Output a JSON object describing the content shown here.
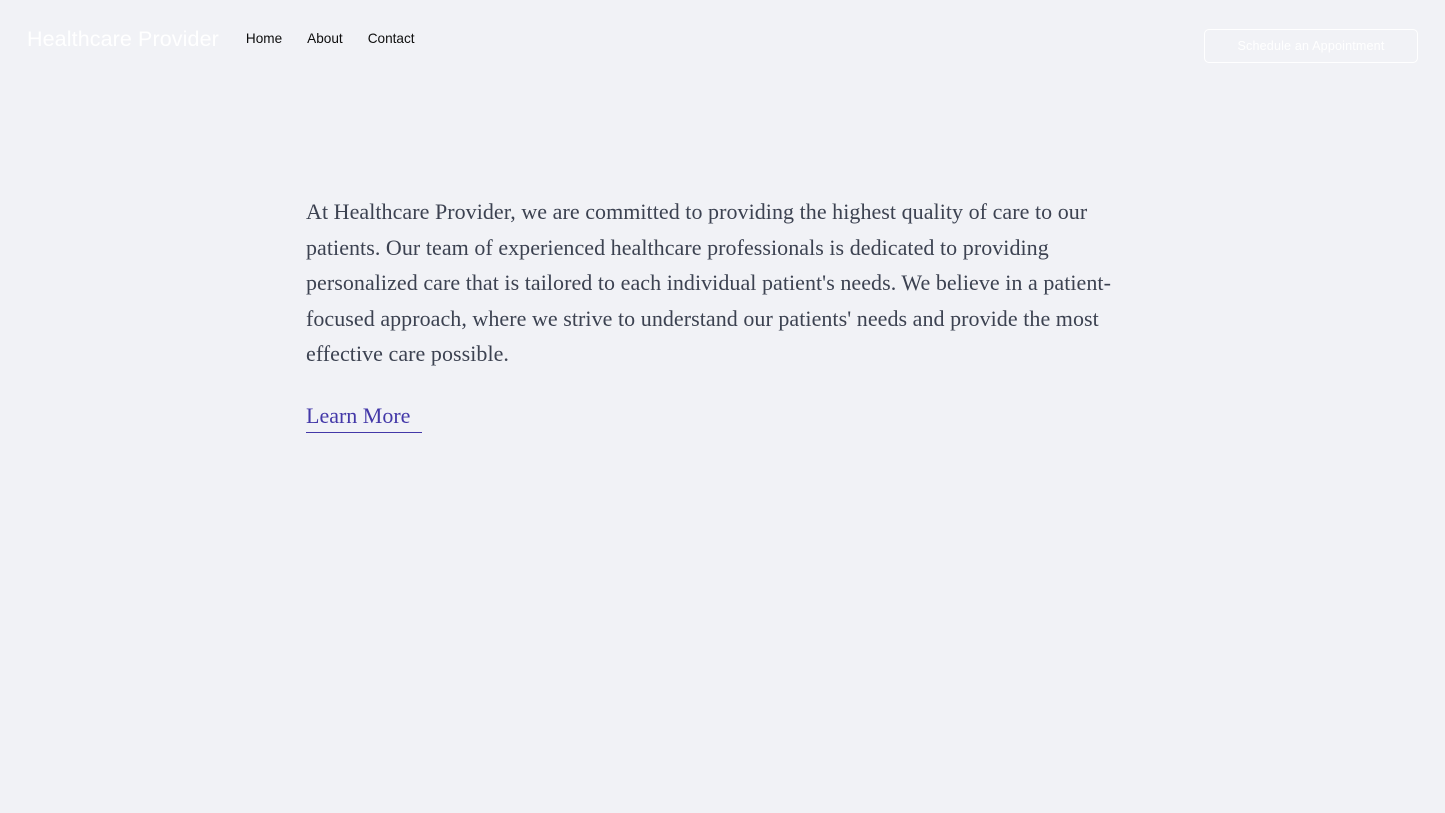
{
  "page": {
    "background_color": "#f1f2f6",
    "body_text_color": "#3c4251",
    "link_color": "#4338a8",
    "header_text_color": "#ffffff"
  },
  "header": {
    "brand": "Healthcare Provider",
    "nav": [
      {
        "label": "Home"
      },
      {
        "label": "About"
      },
      {
        "label": "Contact"
      }
    ],
    "cta": {
      "label": "Schedule an Appointment"
    }
  },
  "main": {
    "intro_paragraph": "At Healthcare Provider, we are committed to providing the highest quality of care to our patients. Our team of experienced healthcare professionals is dedicated to providing personalized care that is tailored to each individual patient's needs. We believe in a patient-focused approach, where we strive to understand our patients' needs and provide the most effective care possible.",
    "learn_more": {
      "label": "Learn More"
    }
  }
}
